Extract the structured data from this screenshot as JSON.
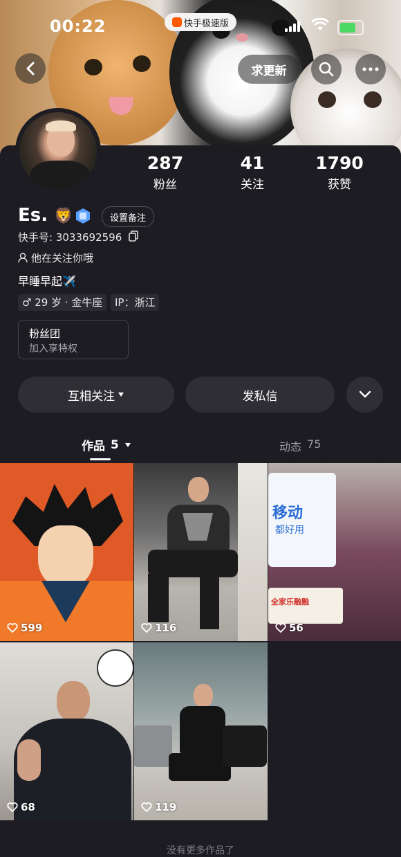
{
  "status_bar": {
    "time": "00:22",
    "app_badge": "快手极速版"
  },
  "header": {
    "update_button": "求更新"
  },
  "profile": {
    "name": "Es.",
    "name_emoji": "🦁",
    "remark_button": "设置备注",
    "kuaishou_id": "快手号: 3033692596",
    "follows_you": "他在关注你哦",
    "bio": "早睡早起✈️",
    "age_tag": "♂ 29 岁 · 金牛座",
    "ip_tag": "IP：浙江",
    "fan_group_title": "粉丝团",
    "fan_group_sub": "加入享特权"
  },
  "stats": [
    {
      "value": "287",
      "label": "粉丝"
    },
    {
      "value": "41",
      "label": "关注"
    },
    {
      "value": "1790",
      "label": "获赞"
    }
  ],
  "actions": {
    "mutual": "互相关注",
    "message": "发私信"
  },
  "tabs": [
    {
      "label": "作品",
      "count": "5"
    },
    {
      "label": "动态",
      "count": "75"
    }
  ],
  "works": [
    {
      "likes": "599"
    },
    {
      "likes": "116"
    },
    {
      "likes": "56"
    },
    {
      "likes": "68"
    },
    {
      "likes": "119"
    }
  ],
  "footer": {
    "text": "没有更多作品了"
  },
  "tile3_text": {
    "line1": "移动",
    "line2": "都好用",
    "line3": "全家乐融融"
  }
}
